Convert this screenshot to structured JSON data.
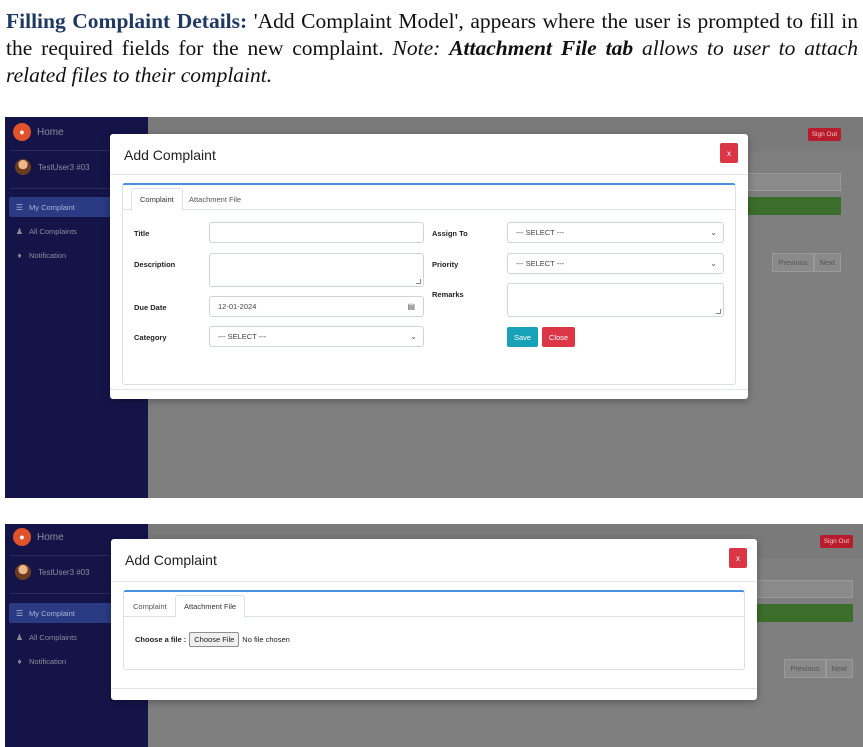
{
  "doc": {
    "lead": "Filling Complaint Details:",
    "body": " 'Add Complaint Model', appears where the user is prompted to fill in the required fields for the new complaint. ",
    "note_prefix": "Note: ",
    "note_bold": "Attachment File tab",
    "note_rest": " allows to user to attach related files to their complaint."
  },
  "app": {
    "home": "Home",
    "user": "TestUser3 #03",
    "menu": [
      "My Complaint",
      "All Complaints",
      "Notification"
    ],
    "sign_out": "Sign Out",
    "pager": [
      "Previous",
      "Next"
    ]
  },
  "modal": {
    "title": "Add Complaint",
    "close_x": "x",
    "tabs": [
      "Complaint",
      "Attachment File"
    ],
    "fields": {
      "title": "Title",
      "description": "Description",
      "due_date": "Due Date",
      "due_date_value": "12-01-2024",
      "category": "Category",
      "category_value": "--- SELECT ---",
      "assign_to": "Assign To",
      "assign_to_value": "--- SELECT ---",
      "priority": "Priority",
      "priority_value": "--- SELECT ---",
      "remarks": "Remarks"
    },
    "save": "Save",
    "close": "Close",
    "attachment": {
      "label": "Choose a file :",
      "button": "Choose File",
      "status": "No file chosen"
    }
  }
}
